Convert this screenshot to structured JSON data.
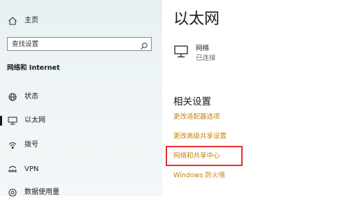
{
  "sidebar": {
    "home_label": "主页",
    "search_placeholder": "查找设置",
    "section_title": "网络和 Internet",
    "items": [
      {
        "label": "状态",
        "icon": "globe-icon"
      },
      {
        "label": "以太网",
        "icon": "ethernet-icon",
        "active": true
      },
      {
        "label": "拨号",
        "icon": "dialup-icon"
      },
      {
        "label": "VPN",
        "icon": "vpn-icon"
      },
      {
        "label": "数据使用量",
        "icon": "data-usage-icon"
      }
    ]
  },
  "main": {
    "title": "以太网",
    "network": {
      "name": "网络",
      "status": "已连接",
      "icon": "ethernet-monitor-icon"
    },
    "related_title": "相关设置",
    "links": [
      "更改适配器选项",
      "更改高级共享设置",
      "网络和共享中心",
      "Windows 防火墙"
    ],
    "highlighted_link_index": 2
  },
  "colors": {
    "link": "#c5830a",
    "highlight_box": "#e3322d",
    "sidebar_bg": "#e9f2f4"
  }
}
